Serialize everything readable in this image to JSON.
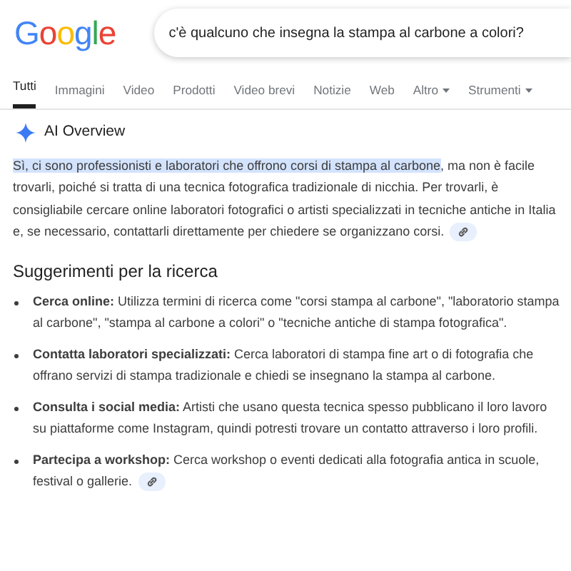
{
  "logo": "Google",
  "search": {
    "value": "c'è qualcuno che insegna la stampa al carbone a colori?"
  },
  "tabs": [
    {
      "label": "Tutti",
      "selected": true,
      "dropdown": false
    },
    {
      "label": "Immagini",
      "selected": false,
      "dropdown": false
    },
    {
      "label": "Video",
      "selected": false,
      "dropdown": false
    },
    {
      "label": "Prodotti",
      "selected": false,
      "dropdown": false
    },
    {
      "label": "Video brevi",
      "selected": false,
      "dropdown": false
    },
    {
      "label": "Notizie",
      "selected": false,
      "dropdown": false
    },
    {
      "label": "Web",
      "selected": false,
      "dropdown": false
    },
    {
      "label": "Altro",
      "selected": false,
      "dropdown": true
    },
    {
      "label": "Strumenti",
      "selected": false,
      "dropdown": true
    }
  ],
  "ai_overview": {
    "title": "AI Overview",
    "highlighted": "Sì, ci sono professionisti e laboratori che offrono corsi di stampa al carbone",
    "text": ", ma non è facile trovarli, poiché si tratta di una tecnica fotografica tradizionale di nicchia. Per trovarli, è consigliabile cercare online laboratori fotografici o artisti specializzati in tecniche antiche in Italia e, se necessario, contattarli direttamente per chiedere se organizzano corsi.",
    "link": true,
    "heading": "Suggerimenti per la ricerca",
    "bullets": [
      {
        "text": "**Cerca online:** Utilizza termini di ricerca come \"corsi stampa al carbone\", \"laboratorio stampa al carbone\", \"stampa al carbone a colori\" o \"tecniche antiche di stampa fotografica\".",
        "link": false
      },
      {
        "text": "**Contatta laboratori specializzati:** Cerca laboratori di stampa fine art o di fotografia che offrano servizi di stampa tradizionale e chiedi se insegnano la stampa al carbone.",
        "link": false
      },
      {
        "text": "**Consulta i social media:** Artisti che usano questa tecnica spesso pubblicano il loro lavoro su piattaforme come Instagram, quindi potresti trovare un contatto attraverso i loro profili.",
        "link": false
      },
      {
        "text": "**Partecipa a workshop:** Cerca workshop o eventi dedicati alla fotografia antica in scuole, festival o gallerie.",
        "link": true
      }
    ]
  }
}
